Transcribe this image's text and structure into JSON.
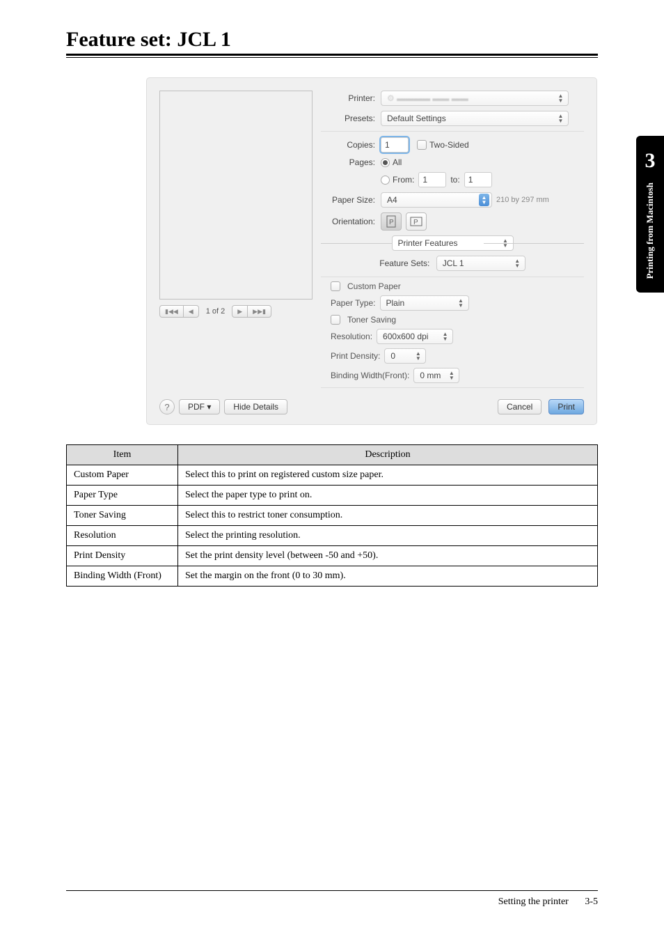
{
  "heading": "Feature set: JCL 1",
  "sideTab": {
    "number": "3",
    "text": "Printing from Macintosh"
  },
  "dialog": {
    "printer": {
      "label": "Printer:",
      "value": ""
    },
    "presets": {
      "label": "Presets:",
      "value": "Default Settings"
    },
    "copies": {
      "label": "Copies:",
      "value": "1",
      "twoSided": "Two-Sided"
    },
    "pages": {
      "label": "Pages:",
      "all": "All",
      "fromLabel": "From:",
      "fromValue": "1",
      "toLabel": "to:",
      "toValue": "1"
    },
    "paperSize": {
      "label": "Paper Size:",
      "value": "A4",
      "dims": "210 by 297 mm"
    },
    "orientation": {
      "label": "Orientation:"
    },
    "section": {
      "value": "Printer Features"
    },
    "featureSets": {
      "label": "Feature Sets:",
      "value": "JCL 1"
    },
    "customPaper": {
      "label": "Custom Paper"
    },
    "paperType": {
      "label": "Paper Type:",
      "value": "Plain"
    },
    "tonerSaving": {
      "label": "Toner Saving"
    },
    "resolution": {
      "label": "Resolution:",
      "value": "600x600 dpi"
    },
    "printDensity": {
      "label": "Print Density:",
      "value": "0"
    },
    "bindingWidth": {
      "label": "Binding Width(Front):",
      "value": "0 mm"
    },
    "pager": "1 of 2",
    "help": "?",
    "pdf": "PDF ▾",
    "hideDetails": "Hide Details",
    "cancel": "Cancel",
    "print": "Print"
  },
  "table": {
    "headers": [
      "Item",
      "Description"
    ],
    "rows": [
      [
        "Custom Paper",
        "Select this to print on registered custom size paper."
      ],
      [
        "Paper Type",
        "Select the paper type to print on."
      ],
      [
        "Toner Saving",
        "Select this to restrict toner consumption."
      ],
      [
        "Resolution",
        "Select the printing resolution."
      ],
      [
        "Print Density",
        "Set the print density level (between -50 and +50)."
      ],
      [
        "Binding Width (Front)",
        "Set the margin on the front (0 to 30 mm)."
      ]
    ]
  },
  "footer": {
    "section": "Setting the printer",
    "page": "3-5"
  }
}
